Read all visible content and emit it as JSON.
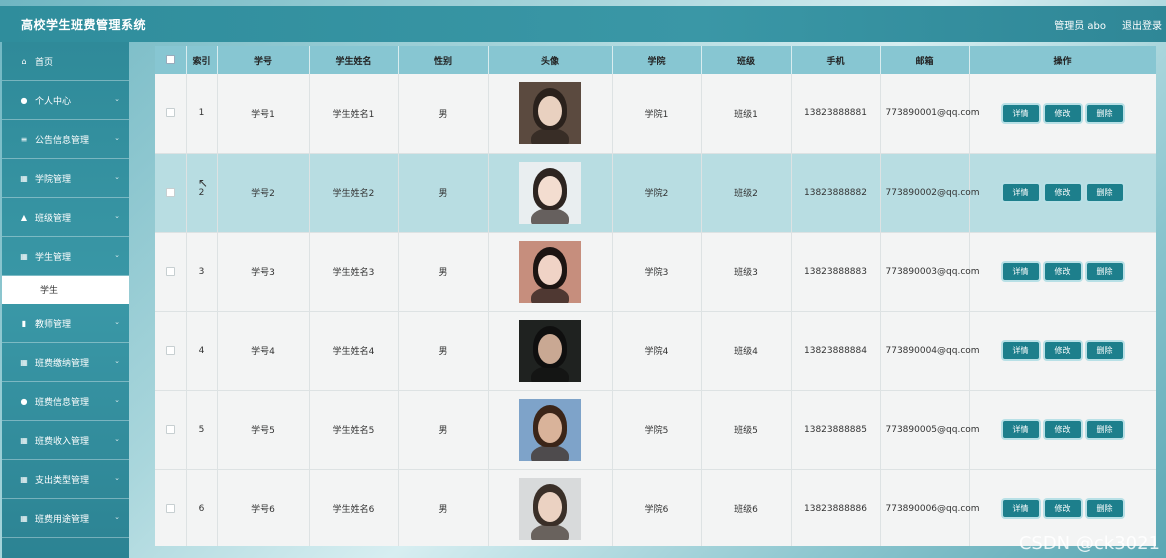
{
  "header": {
    "title": "高校学生班费管理系统",
    "user": "管理员 abo",
    "logout": "退出登录"
  },
  "sidebar": {
    "items": [
      {
        "label": "首页",
        "icon": "home-icon",
        "glyph": "⌂",
        "chevron": false
      },
      {
        "label": "个人中心",
        "icon": "user-icon",
        "glyph": "●",
        "chevron": true
      },
      {
        "label": "公告信息管理",
        "icon": "list-icon",
        "glyph": "≡",
        "chevron": true
      },
      {
        "label": "学院管理",
        "icon": "grid-icon",
        "glyph": "▦",
        "chevron": true
      },
      {
        "label": "班级管理",
        "icon": "thumb-icon",
        "glyph": "▲",
        "chevron": true
      },
      {
        "label": "学生管理",
        "icon": "grid-icon",
        "glyph": "▦",
        "chevron": true,
        "expanded": true
      },
      {
        "label": "教师管理",
        "icon": "bar-icon",
        "glyph": "▮",
        "chevron": true
      },
      {
        "label": "班费缴纳管理",
        "icon": "grid-icon",
        "glyph": "▦",
        "chevron": true
      },
      {
        "label": "班费信息管理",
        "icon": "person-icon",
        "glyph": "●",
        "chevron": true
      },
      {
        "label": "班费收入管理",
        "icon": "grid-icon",
        "glyph": "▦",
        "chevron": true
      },
      {
        "label": "支出类型管理",
        "icon": "grid-icon",
        "glyph": "▦",
        "chevron": true
      },
      {
        "label": "班费用途管理",
        "icon": "grid-icon",
        "glyph": "▦",
        "chevron": true
      }
    ],
    "subitem": "学生"
  },
  "table": {
    "columns": [
      "索引",
      "学号",
      "学生姓名",
      "性别",
      "头像",
      "学院",
      "班级",
      "手机",
      "邮箱",
      "操作"
    ],
    "actions": {
      "detail": "详情",
      "edit": "修改",
      "delete": "删除"
    },
    "rows": [
      {
        "idx": "1",
        "no": "学号1",
        "name": "学生姓名1",
        "sex": "男",
        "college": "学院1",
        "cls": "班级1",
        "phone": "13823888881",
        "email": "773890001@qq.com",
        "avatar": {
          "bg": "#5b4a3f",
          "face": "#e9d1c0",
          "hair": "#2a211c"
        }
      },
      {
        "idx": "2",
        "no": "学号2",
        "name": "学生姓名2",
        "sex": "男",
        "college": "学院2",
        "cls": "班级2",
        "phone": "13823888882",
        "email": "773890002@qq.com",
        "avatar": {
          "bg": "#e9eef0",
          "face": "#f3ddd0",
          "hair": "#2d2420"
        }
      },
      {
        "idx": "3",
        "no": "学号3",
        "name": "学生姓名3",
        "sex": "男",
        "college": "学院3",
        "cls": "班级3",
        "phone": "13823888883",
        "email": "773890003@qq.com",
        "avatar": {
          "bg": "#c68e7d",
          "face": "#f0d3c6",
          "hair": "#1c1412"
        }
      },
      {
        "idx": "4",
        "no": "学号4",
        "name": "学生姓名4",
        "sex": "男",
        "college": "学院4",
        "cls": "班级4",
        "phone": "13823888884",
        "email": "773890004@qq.com",
        "avatar": {
          "bg": "#1f2220",
          "face": "#c9a893",
          "hair": "#0f0f0f"
        }
      },
      {
        "idx": "5",
        "no": "学号5",
        "name": "学生姓名5",
        "sex": "男",
        "college": "学院5",
        "cls": "班级5",
        "phone": "13823888885",
        "email": "773890005@qq.com",
        "avatar": {
          "bg": "#7ea3c9",
          "face": "#d9b39a",
          "hair": "#3b2518"
        }
      },
      {
        "idx": "6",
        "no": "学号6",
        "name": "学生姓名6",
        "sex": "男",
        "college": "学院6",
        "cls": "班级6",
        "phone": "13823888886",
        "email": "773890006@qq.com",
        "avatar": {
          "bg": "#d8dadb",
          "face": "#ebd2c2",
          "hair": "#3a2f28"
        }
      }
    ]
  },
  "watermark": "CSDN @ck3021"
}
